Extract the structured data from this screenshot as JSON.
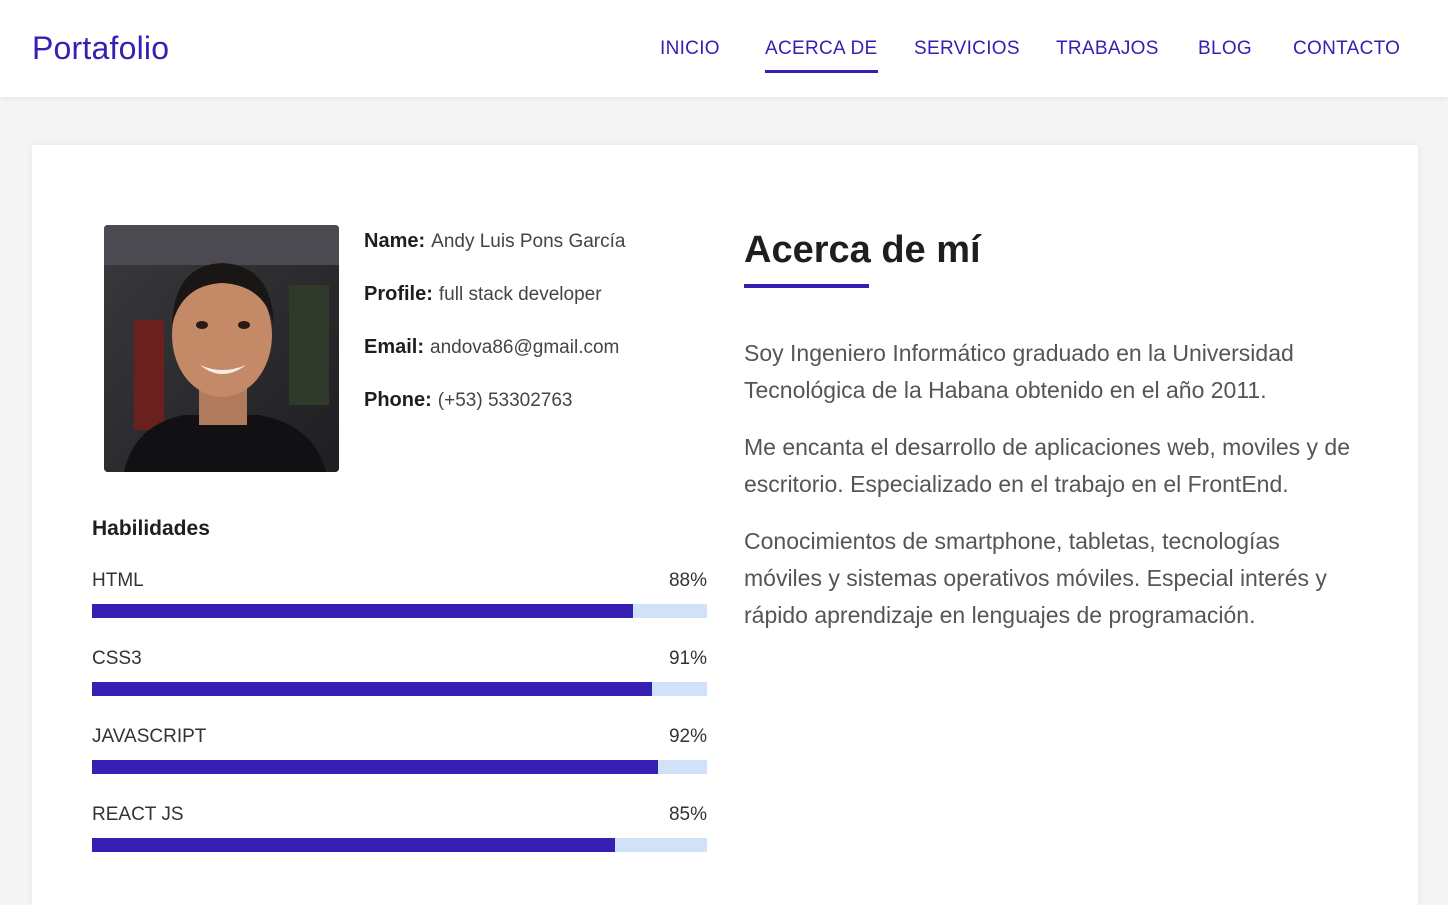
{
  "header": {
    "brand": "Portafolio",
    "nav": [
      "INICIO",
      "ACERCA DE",
      "SERVICIOS",
      "TRABAJOS",
      "BLOG",
      "CONTACTO"
    ],
    "active": "ACERCA DE"
  },
  "profile": {
    "name_label": "Name:",
    "name_value": "Andy Luis Pons García",
    "profile_label": "Profile:",
    "profile_value": "full stack developer",
    "email_label": "Email:",
    "email_value": "andova86@gmail.com",
    "phone_label": "Phone:",
    "phone_value": "(+53) 53302763"
  },
  "skills": {
    "title": "Habilidades",
    "items": [
      {
        "name": "HTML",
        "percent_label": "88%",
        "percent": 88
      },
      {
        "name": "CSS3",
        "percent_label": "91%",
        "percent": 91
      },
      {
        "name": "JAVASCRIPT",
        "percent_label": "92%",
        "percent": 92
      },
      {
        "name": "REACT JS",
        "percent_label": "85%",
        "percent": 85
      }
    ]
  },
  "about": {
    "title": "Acerca de mí",
    "paragraphs": [
      "Soy Ingeniero Informático graduado en la Universidad Tecnológica de la Habana obtenido en el año 2011.",
      "Me encanta el desarrollo de aplicaciones web, moviles y de escritorio. Especializado en el trabajo en el FrontEnd.",
      "Conocimientos de smartphone, tabletas, tecnologías móviles y sistemas operativos móviles. Especial interés y rápido aprendizaje en lenguajes de programación."
    ]
  },
  "colors": {
    "accent": "#3520b3",
    "bar_track": "#cfe2f7",
    "page_bg": "#f5f5f5"
  }
}
